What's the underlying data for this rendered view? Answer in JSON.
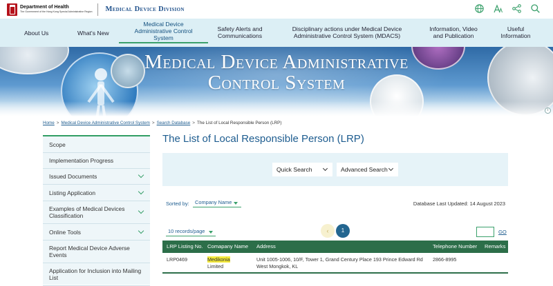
{
  "header": {
    "org_line1": "Department of Health",
    "org_line2": "The Government of the Hong Kong Special Administrative Region",
    "division": "Medical Device Division",
    "icons": [
      "globe-icon",
      "font-size-icon",
      "share-icon",
      "search-icon"
    ]
  },
  "nav": {
    "items": [
      {
        "label": "About Us"
      },
      {
        "label": "What's New"
      },
      {
        "label": "Medical Device Administrative Control System",
        "active": true
      },
      {
        "label": "Safety Alerts and Communications"
      },
      {
        "label": "Disciplinary actions under Medical Device Administrative Control System (MDACS)"
      },
      {
        "label": "Information, Video and Publication"
      },
      {
        "label": "Useful Information"
      }
    ]
  },
  "banner": {
    "line1": "Medical Device Administrative",
    "line2": "Control System"
  },
  "breadcrumb": {
    "items": [
      "Home",
      "Medical Device Administrative Control System",
      "Search Database",
      "The List of Local Responsible Person (LRP)"
    ]
  },
  "sidebar": {
    "items": [
      {
        "label": "Scope",
        "expandable": false
      },
      {
        "label": "Implementation Progress",
        "expandable": false
      },
      {
        "label": "Issued Documents",
        "expandable": true
      },
      {
        "label": "Listing Application",
        "expandable": true
      },
      {
        "label": "Examples of Medical Devices Classification",
        "expandable": true
      },
      {
        "label": "Online Tools",
        "expandable": true
      },
      {
        "label": "Report Medical Device Adverse Events",
        "expandable": false
      },
      {
        "label": "Application for Inclusion into Mailing List",
        "expandable": false
      }
    ]
  },
  "main": {
    "title": "The List of Local Responsible Person (LRP)",
    "search": {
      "quick_label": "Quick Search",
      "advanced_label": "Advanced Search"
    },
    "sort": {
      "label": "Sorted by:",
      "value": "Company Name"
    },
    "db_updated": "Database Last Updated: 14 August 2023",
    "per_page": "10 records/page",
    "pagination": {
      "prev": "‹",
      "current": "1",
      "go_label": "GO"
    },
    "table": {
      "headers": [
        "LRP Listing No.",
        "Comapany Name",
        "Address",
        "Telephone Number",
        "Remarks"
      ],
      "rows": [
        {
          "listing_no": "LRP0469",
          "company_line1": "Medikonia",
          "company_line2": "Limited",
          "address_line1": "Unit 1005-1006, 10/F, Tower 1, Grand Century Place 193 Prince Edward Rd",
          "address_line2": "West Mongkok, KL",
          "telephone": "2866-8995",
          "remarks": ""
        }
      ]
    }
  },
  "colors": {
    "nav_bg": "#dceff5",
    "accent_green": "#3aa06b",
    "table_header": "#2c6e49",
    "title_blue": "#1d5c8f",
    "highlight": "#f5ea3a"
  }
}
